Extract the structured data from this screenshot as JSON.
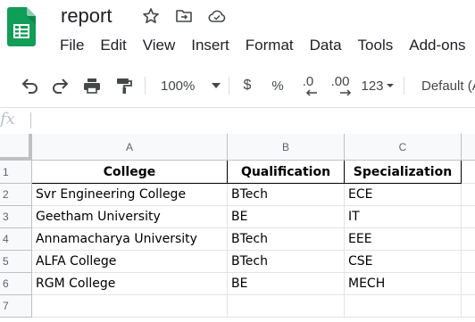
{
  "header": {
    "title": "report",
    "menu": [
      "File",
      "Edit",
      "View",
      "Insert",
      "Format",
      "Data",
      "Tools",
      "Add-ons"
    ]
  },
  "toolbar": {
    "zoom": "100%",
    "currency": "$",
    "percent": "%",
    "decrease_decimal": ".0",
    "increase_decimal": ".00",
    "more_formats": "123",
    "font": "Default (Ari"
  },
  "formula_bar": {
    "label": "fx"
  },
  "grid": {
    "columns": [
      "A",
      "B",
      "C"
    ],
    "rows": [
      "1",
      "2",
      "3",
      "4",
      "5",
      "6",
      "7"
    ],
    "header": [
      "College",
      "Qualification",
      "Specialization"
    ],
    "data": [
      [
        "Svr Engineering College",
        "BTech",
        "ECE"
      ],
      [
        "Geetham University",
        "BE",
        "IT"
      ],
      [
        "Annamacharya University",
        "BTech",
        "EEE"
      ],
      [
        "ALFA College",
        "BTech",
        "CSE"
      ],
      [
        "RGM College",
        "BE",
        "MECH"
      ]
    ]
  },
  "colors": {
    "logo_green": "#0f9d58",
    "logo_dark_green": "#087f3f"
  },
  "icons": [
    "sheets-logo-icon",
    "star-icon",
    "move-folder-icon",
    "cloud-saved-icon",
    "undo-icon",
    "redo-icon",
    "print-icon",
    "paint-format-icon",
    "chevron-down-icon"
  ]
}
